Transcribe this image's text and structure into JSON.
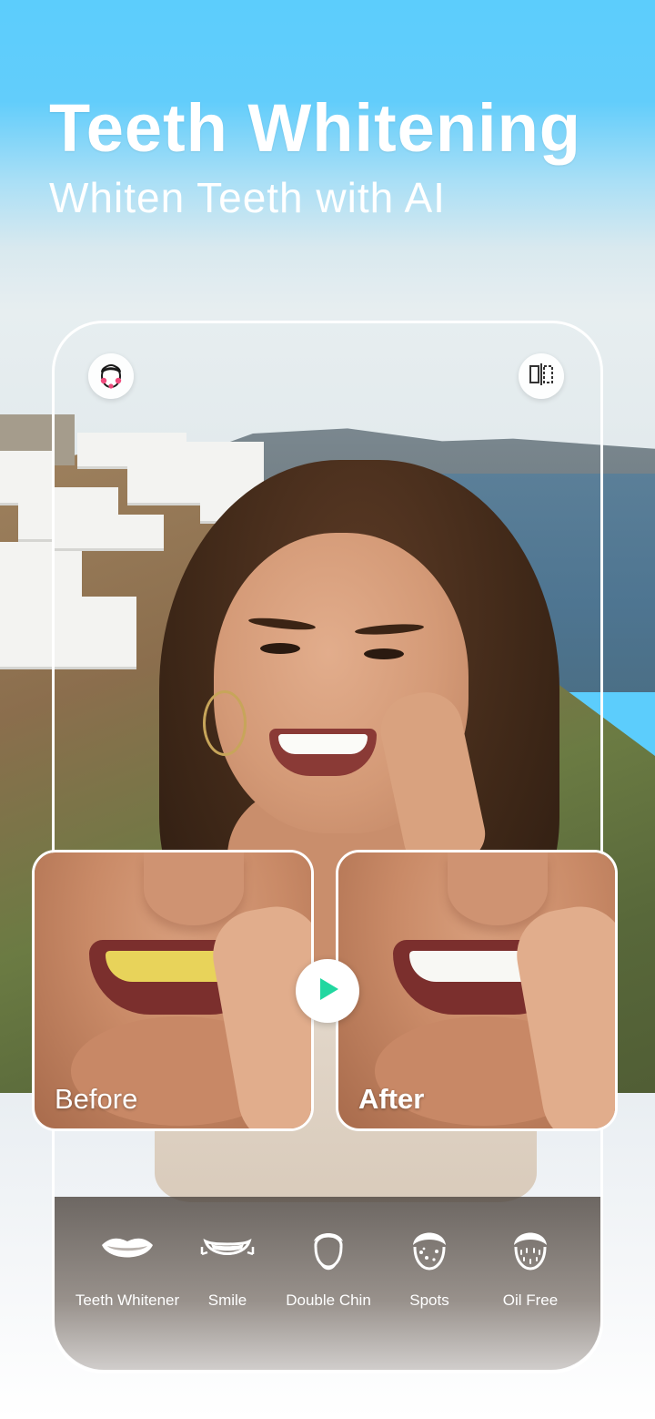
{
  "header": {
    "title": "Teeth Whitening",
    "subtitle": "Whiten Teeth with AI"
  },
  "top_buttons": {
    "left_icon": "face-retouch-icon",
    "right_icon": "compare-split-icon"
  },
  "comparison": {
    "before_label": "Before",
    "after_label": "After",
    "play_icon": "play-icon",
    "colors": {
      "before_teeth": "#e8d35a",
      "after_teeth": "#f8f8f4",
      "play_accent": "#21d7a0"
    }
  },
  "tools": [
    {
      "label": "Teeth Whitener",
      "icon": "lips-icon"
    },
    {
      "label": "Smile",
      "icon": "smile-icon"
    },
    {
      "label": "Double Chin",
      "icon": "double-chin-icon"
    },
    {
      "label": "Spots",
      "icon": "spots-icon"
    },
    {
      "label": "Oil Free",
      "icon": "oil-free-icon"
    }
  ],
  "colors": {
    "sky": "#5ccdfc",
    "frame": "#ffffff"
  }
}
